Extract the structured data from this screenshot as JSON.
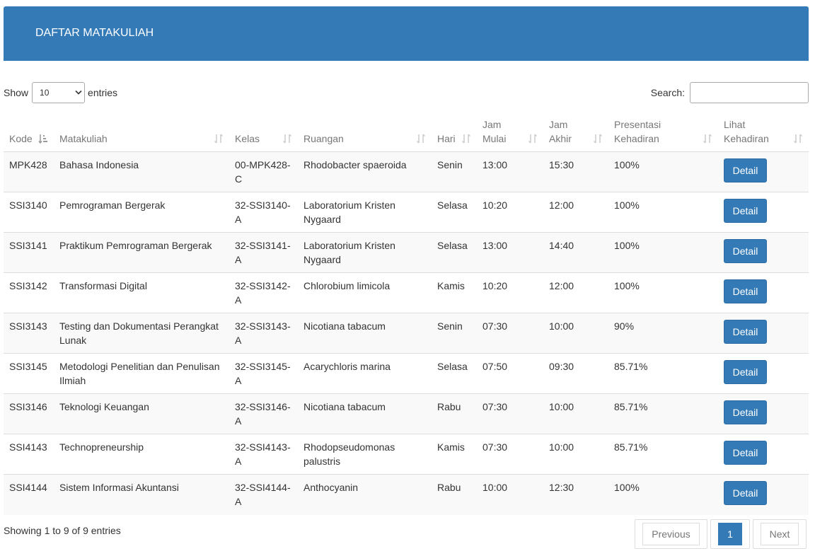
{
  "header": {
    "title": "DAFTAR MATAKULIAH"
  },
  "length": {
    "show_label": "Show",
    "selected": "10",
    "entries_label": "entries"
  },
  "search": {
    "label": "Search:",
    "value": ""
  },
  "columns": [
    {
      "line1": "Kode",
      "line2": "",
      "sort": "asc"
    },
    {
      "line1": "Matakuliah",
      "line2": "",
      "sort": "none"
    },
    {
      "line1": "Kelas",
      "line2": "",
      "sort": "none"
    },
    {
      "line1": "Ruangan",
      "line2": "",
      "sort": "none"
    },
    {
      "line1": "Hari",
      "line2": "",
      "sort": "none"
    },
    {
      "line1": "Jam",
      "line2": "Mulai",
      "sort": "none"
    },
    {
      "line1": "Jam",
      "line2": "Akhir",
      "sort": "none"
    },
    {
      "line1": "Presentasi",
      "line2": "Kehadiran",
      "sort": "none"
    },
    {
      "line1": "Lihat",
      "line2": "Kehadiran",
      "sort": "none"
    }
  ],
  "rows": [
    {
      "kode": "MPK428",
      "matakuliah": "Bahasa Indonesia",
      "kelas1": "00-MPK428-",
      "kelas2": "C",
      "ruangan": "Rhodobacter spaeroida",
      "hari": "Senin",
      "mulai": "13:00",
      "akhir": "15:30",
      "presentasi": "100%",
      "action": "Detail"
    },
    {
      "kode": "SSI3140",
      "matakuliah": "Pemrograman Bergerak",
      "kelas1": "32-SSI3140-",
      "kelas2": "A",
      "ruangan": "Laboratorium Kristen Nygaard",
      "hari": "Selasa",
      "mulai": "10:20",
      "akhir": "12:00",
      "presentasi": "100%",
      "action": "Detail"
    },
    {
      "kode": "SSI3141",
      "matakuliah": "Praktikum Pemrograman Bergerak",
      "kelas1": "32-SSI3141-",
      "kelas2": "A",
      "ruangan": "Laboratorium Kristen Nygaard",
      "hari": "Selasa",
      "mulai": "13:00",
      "akhir": "14:40",
      "presentasi": "100%",
      "action": "Detail"
    },
    {
      "kode": "SSI3142",
      "matakuliah": "Transformasi Digital",
      "kelas1": "32-SSI3142-",
      "kelas2": "A",
      "ruangan": "Chlorobium limicola",
      "hari": "Kamis",
      "mulai": "10:20",
      "akhir": "12:00",
      "presentasi": "100%",
      "action": "Detail"
    },
    {
      "kode": "SSI3143",
      "matakuliah": "Testing dan Dokumentasi Perangkat Lunak",
      "kelas1": "32-SSI3143-",
      "kelas2": "A",
      "ruangan": "Nicotiana tabacum",
      "hari": "Senin",
      "mulai": "07:30",
      "akhir": "10:00",
      "presentasi": "90%",
      "action": "Detail"
    },
    {
      "kode": "SSI3145",
      "matakuliah": "Metodologi Penelitian dan Penulisan Ilmiah",
      "kelas1": "32-SSI3145-",
      "kelas2": "A",
      "ruangan": "Acarychloris marina",
      "hari": "Selasa",
      "mulai": "07:50",
      "akhir": "09:30",
      "presentasi": "85.71%",
      "action": "Detail"
    },
    {
      "kode": "SSI3146",
      "matakuliah": "Teknologi Keuangan",
      "kelas1": "32-SSI3146-",
      "kelas2": "A",
      "ruangan": "Nicotiana tabacum",
      "hari": "Rabu",
      "mulai": "07:30",
      "akhir": "10:00",
      "presentasi": "85.71%",
      "action": "Detail"
    },
    {
      "kode": "SSI4143",
      "matakuliah": "Technopreneurship",
      "kelas1": "32-SSI4143-",
      "kelas2": "A",
      "ruangan": "Rhodopseudomonas palustris",
      "hari": "Kamis",
      "mulai": "07:30",
      "akhir": "10:00",
      "presentasi": "85.71%",
      "action": "Detail"
    },
    {
      "kode": "SSI4144",
      "matakuliah": "Sistem Informasi Akuntansi",
      "kelas1": "32-SSI4144-",
      "kelas2": "A",
      "ruangan": "Anthocyanin",
      "hari": "Rabu",
      "mulai": "10:00",
      "akhir": "12:30",
      "presentasi": "100%",
      "action": "Detail"
    }
  ],
  "footer": {
    "info": "Showing 1 to 9 of 9 entries",
    "previous": "Previous",
    "current_page": "1",
    "next": "Next"
  },
  "colors": {
    "primary": "#337ab7",
    "muted": "#777777",
    "stripe": "#f9f9f9",
    "border": "#dddddd"
  }
}
